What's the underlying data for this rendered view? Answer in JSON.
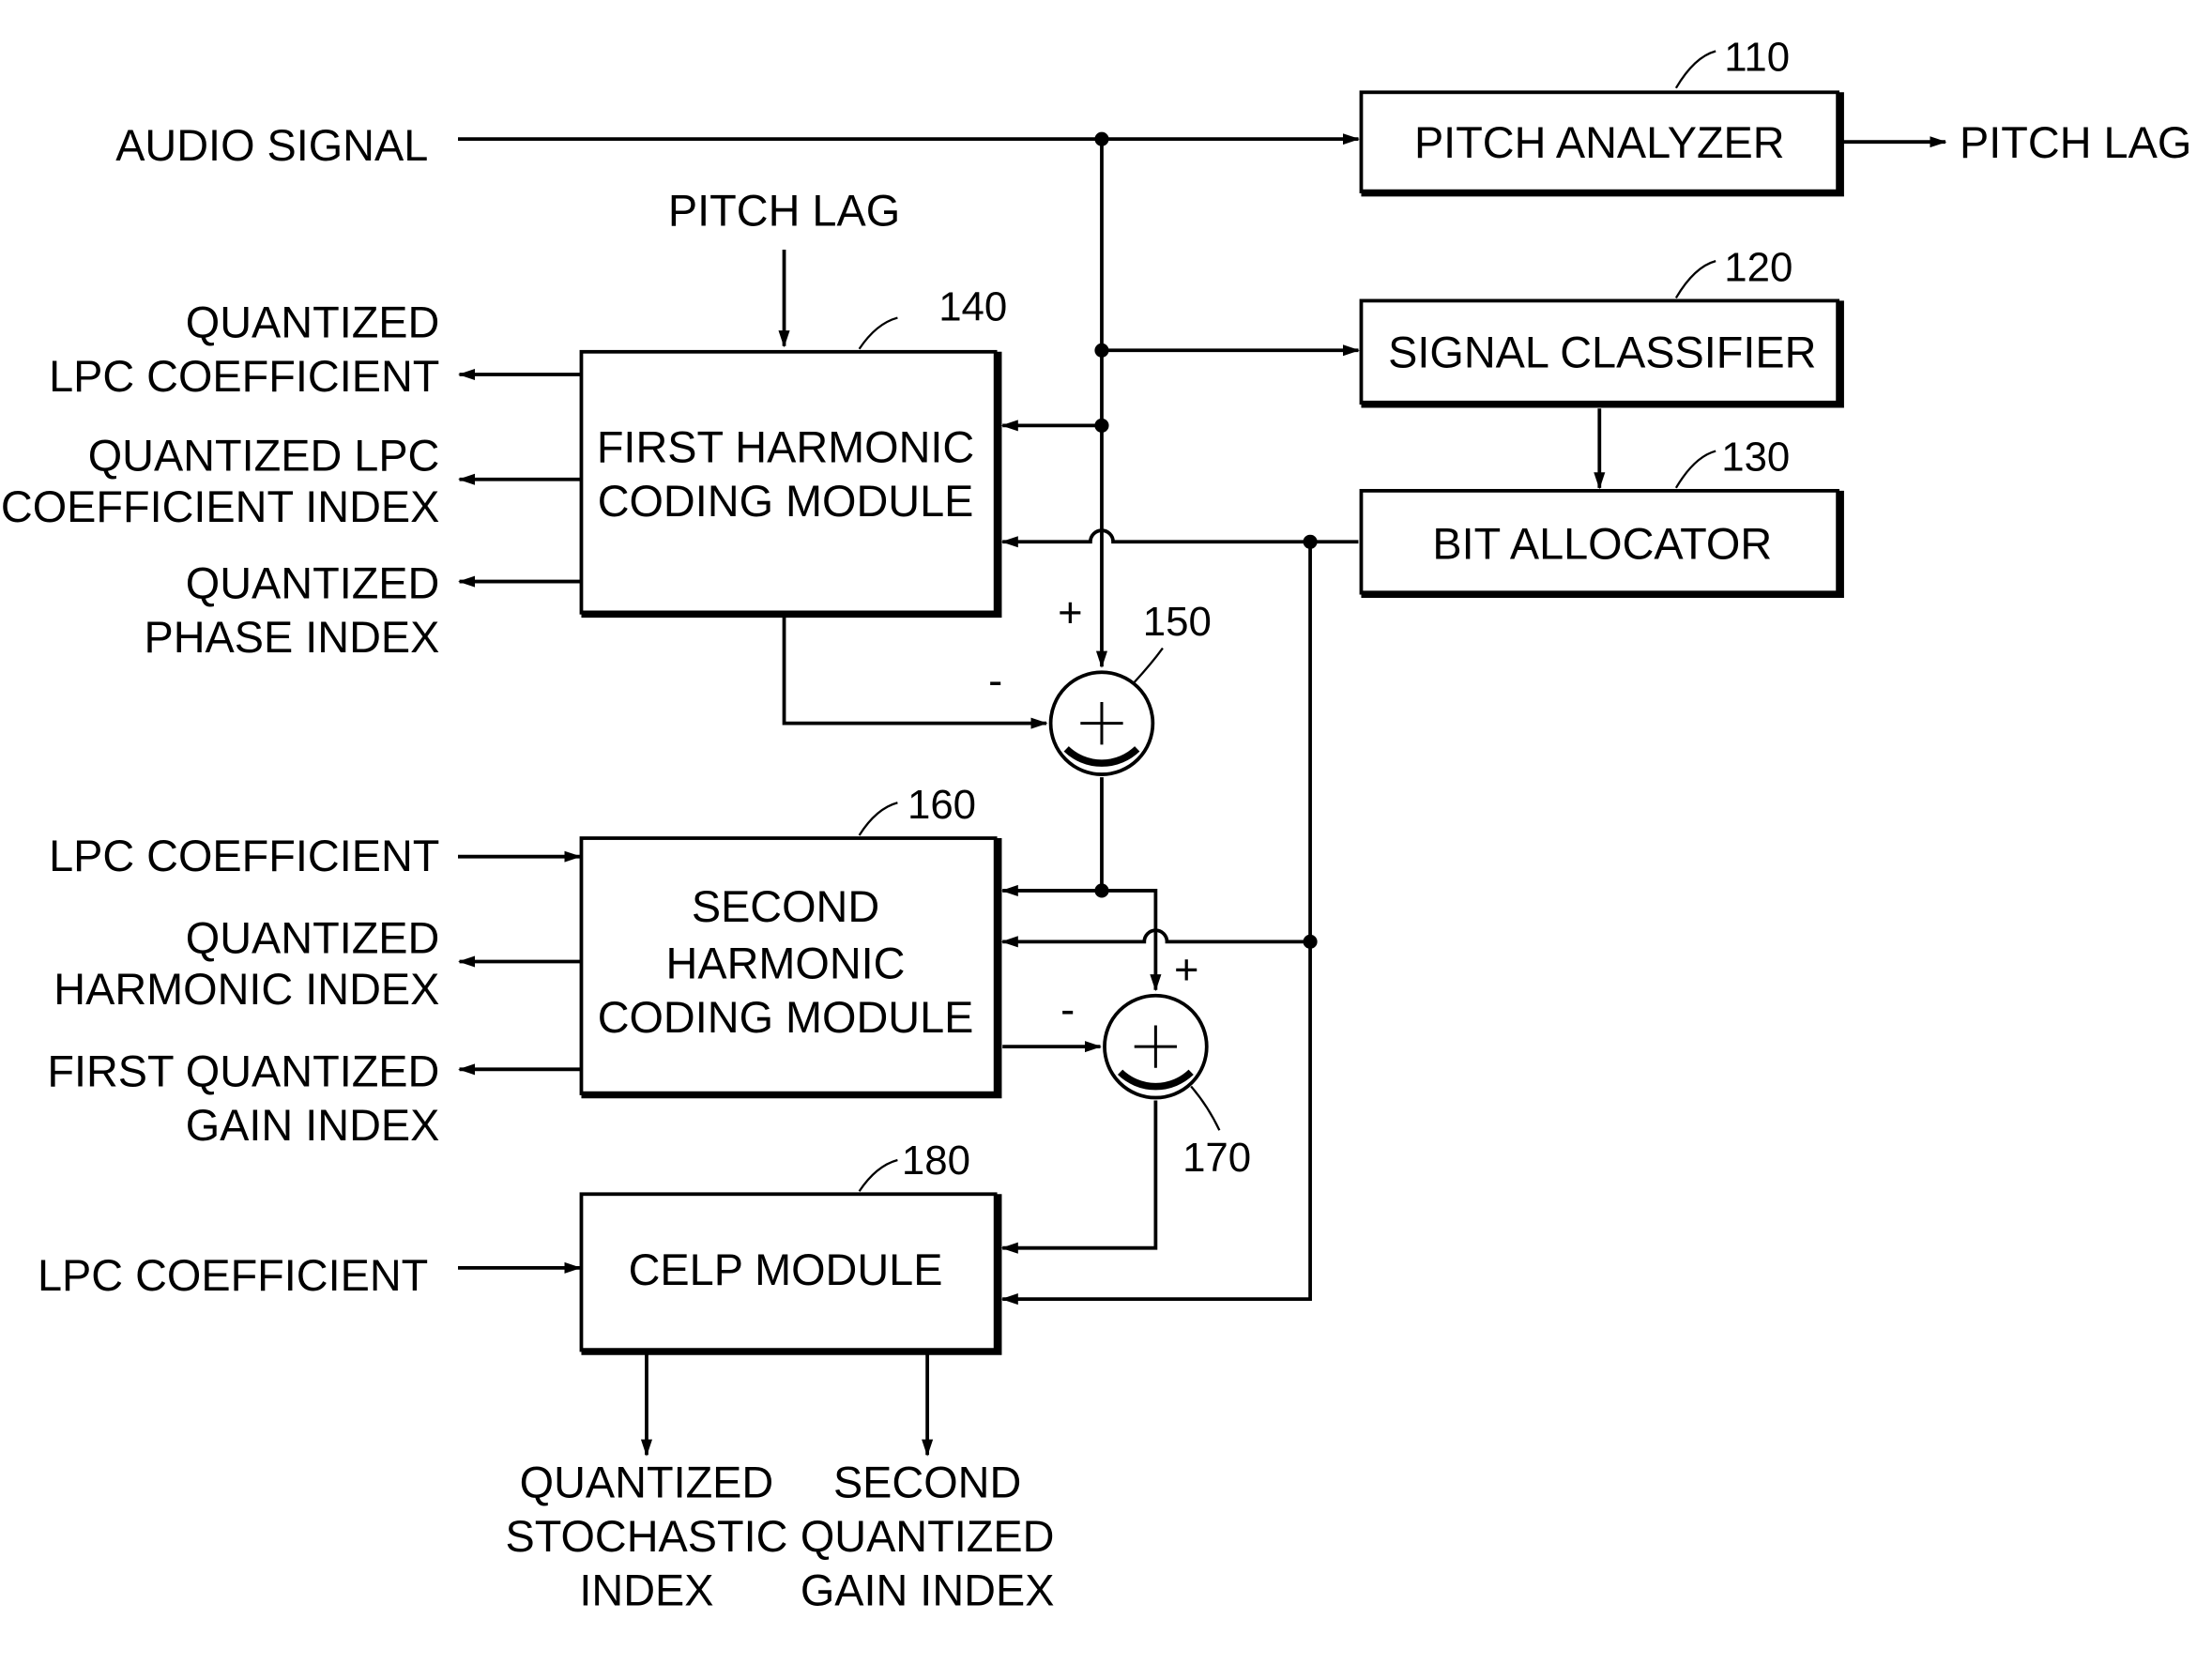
{
  "diagram": {
    "blocks": {
      "pitch_analyzer": {
        "title": [
          "PITCH ANALYZER"
        ],
        "ref": "110"
      },
      "signal_classifier": {
        "title": [
          "SIGNAL CLASSIFIER"
        ],
        "ref": "120"
      },
      "bit_allocator": {
        "title": [
          "BIT ALLOCATOR"
        ],
        "ref": "130"
      },
      "first_harmonic": {
        "title": [
          "FIRST HARMONIC",
          "CODING MODULE"
        ],
        "ref": "140"
      },
      "adder_150": {
        "ref": "150",
        "plus_sign": "+",
        "minus_sign": "-"
      },
      "second_harmonic": {
        "title": [
          "SECOND",
          "HARMONIC",
          "CODING MODULE"
        ],
        "ref": "160"
      },
      "adder_170": {
        "ref": "170",
        "plus_sign": "+",
        "minus_sign": "-"
      },
      "celp": {
        "title": [
          "CELP MODULE"
        ],
        "ref": "180"
      }
    },
    "signals": {
      "audio_signal": [
        "AUDIO SIGNAL"
      ],
      "pitch_lag_out": [
        "PITCH LAG"
      ],
      "pitch_lag_in": [
        "PITCH LAG"
      ],
      "fh_out_1": [
        "QUANTIZED",
        "LPC COEFFICIENT"
      ],
      "fh_out_2": [
        "QUANTIZED LPC",
        "COEFFICIENT INDEX"
      ],
      "fh_out_3": [
        "QUANTIZED",
        "PHASE INDEX"
      ],
      "sh_in_lpc": [
        "LPC COEFFICIENT"
      ],
      "sh_out_1": [
        "QUANTIZED",
        "HARMONIC INDEX"
      ],
      "sh_out_2": [
        "FIRST QUANTIZED",
        "GAIN INDEX"
      ],
      "celp_in_lpc": [
        "LPC COEFFICIENT"
      ],
      "celp_out_1": [
        "QUANTIZED",
        "STOCHASTIC",
        "INDEX"
      ],
      "celp_out_2": [
        "SECOND",
        "QUANTIZED",
        "GAIN INDEX"
      ]
    }
  }
}
